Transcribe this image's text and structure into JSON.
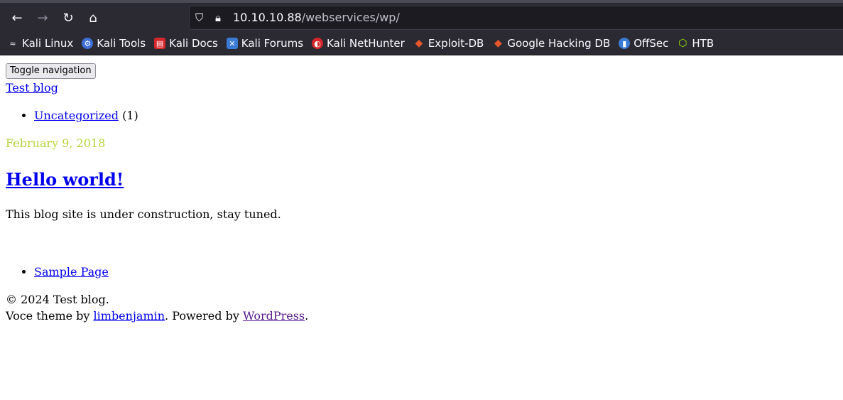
{
  "browser": {
    "url_host": "10.10.10.88",
    "url_path": "/webservices/wp/",
    "nav": {
      "back_icon": "arrow-left-icon",
      "forward_icon": "arrow-right-icon",
      "reload_icon": "reload-icon",
      "home_icon": "home-icon"
    },
    "bookmarks": [
      {
        "label": "Kali Linux",
        "icon": "kali-dragon-icon",
        "color": "#2b2a33"
      },
      {
        "label": "Kali Tools",
        "icon": "kali-tools-icon",
        "color": "#3d6fd6"
      },
      {
        "label": "Kali Docs",
        "icon": "kali-docs-icon",
        "color": "#d7262b"
      },
      {
        "label": "Kali Forums",
        "icon": "kali-forums-icon",
        "color": "#3a7bd5"
      },
      {
        "label": "Kali NetHunter",
        "icon": "nethunter-icon",
        "color": "#d7262b"
      },
      {
        "label": "Exploit-DB",
        "icon": "exploit-db-icon",
        "color": "#e8572a"
      },
      {
        "label": "Google Hacking DB",
        "icon": "ghdb-icon",
        "color": "#e8572a"
      },
      {
        "label": "OffSec",
        "icon": "offsec-icon",
        "color": "#3a7bd5"
      },
      {
        "label": "HTB",
        "icon": "htb-icon",
        "color": "#9fef00"
      }
    ]
  },
  "page": {
    "toggle_label": "Toggle navigation",
    "site_title": "Test blog",
    "categories": [
      {
        "label": "Uncategorized",
        "count": "(1)"
      }
    ],
    "post": {
      "date": "February 9, 2018",
      "title": "Hello world!",
      "excerpt": "This blog site is under construction, stay tuned."
    },
    "footer_links": [
      {
        "label": "Sample Page"
      }
    ],
    "copyright": "© 2024 Test blog.",
    "credits": {
      "prefix": "Voce theme by ",
      "author": "limbenjamin",
      "middle": ". Powered by ",
      "platform": "WordPress",
      "suffix": "."
    }
  }
}
